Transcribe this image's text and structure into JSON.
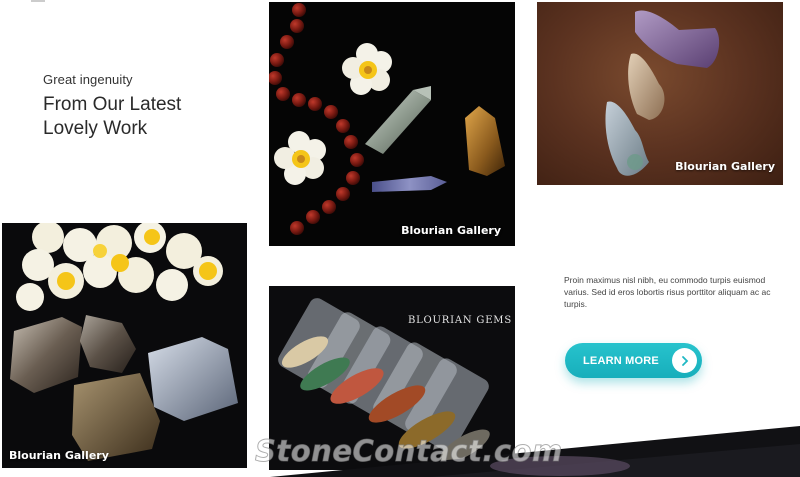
{
  "intro": {
    "kicker": "Great ingenuity",
    "headline_line1": "From Our Latest",
    "headline_line2": "Lovely Work"
  },
  "gallery": {
    "tiles": [
      {
        "caption": "Blourian Gallery"
      },
      {
        "caption": "Blourian Gallery"
      },
      {
        "caption": "Blourian Gallery"
      },
      {
        "brand_mark": "BLOURIAN GEMS"
      }
    ]
  },
  "description": "Proin maximus nisl nibh, eu commodo turpis euismod varius. Sed id eros lobortis risus porttitor aliquam ac ac turpis.",
  "cta": {
    "label": "LEARN MORE",
    "icon": "chevron-right-icon",
    "color": "#1fb8c4"
  },
  "watermark": {
    "text": "StoneContact.com"
  }
}
